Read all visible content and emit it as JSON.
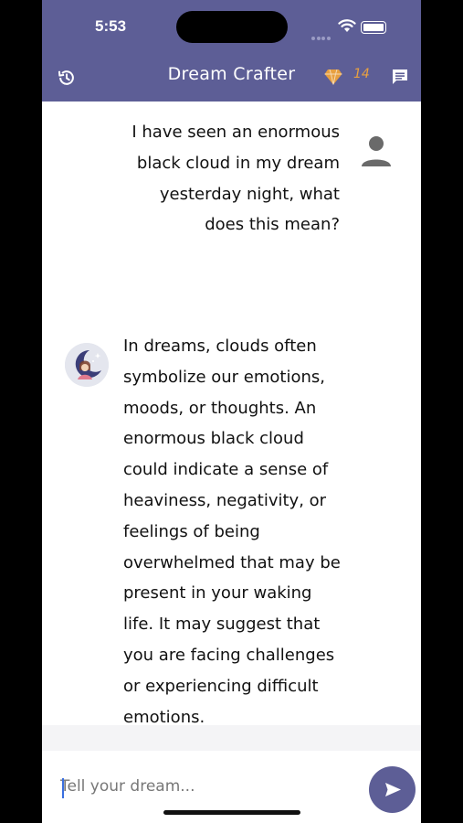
{
  "status_bar": {
    "time": "5:53"
  },
  "header": {
    "title": "Dream Crafter",
    "gem_count": "14",
    "icons": {
      "left": "history-icon",
      "gem": "gem-icon",
      "right": "chat-icon"
    },
    "background": "#5d5e96",
    "gem_color": "#e8a040"
  },
  "messages": [
    {
      "role": "user",
      "text": "I have seen an enormous\nblack cloud in my dream\nyesterday night, what\ndoes this mean?"
    },
    {
      "role": "assistant",
      "text": "In dreams, clouds often\nsymbolize our emotions,\nmoods, or thoughts. An\nenormous black cloud\ncould indicate a sense of\nheaviness, negativity, or\nfeelings of being\noverwhelmed that may be\npresent in your waking\nlife. It may suggest that\nyou are facing challenges\nor experiencing difficult\nemotions."
    }
  ],
  "composer": {
    "placeholder": "Tell your dream...",
    "value": "",
    "send_icon": "send-icon"
  }
}
